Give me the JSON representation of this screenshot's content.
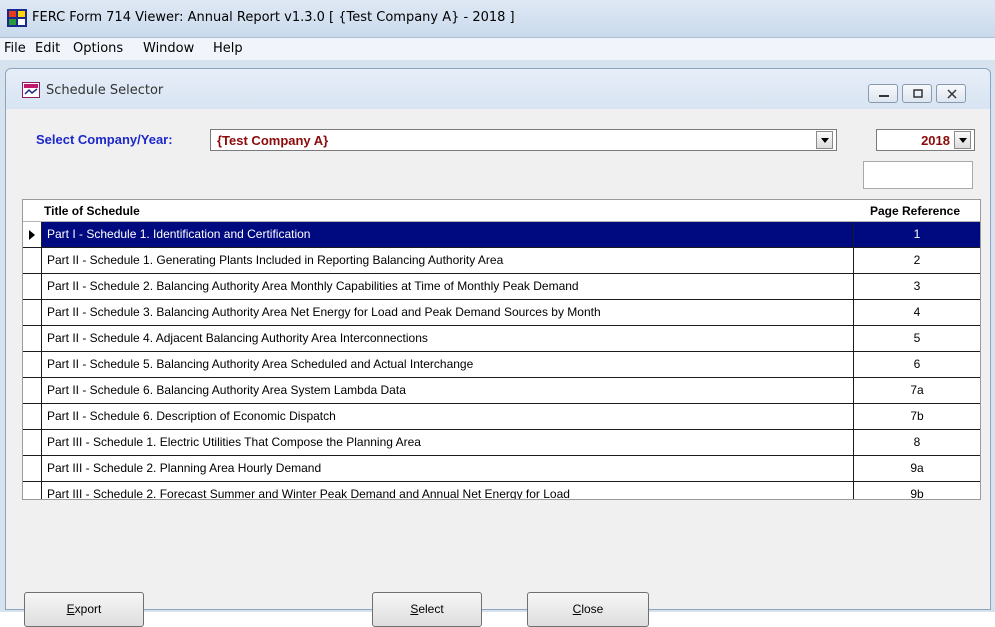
{
  "app": {
    "title": "FERC Form 714 Viewer: Annual Report v1.3.0   [ {Test Company A} - 2018 ]",
    "menu": [
      "File",
      "Edit",
      "Options",
      "Window",
      "Help"
    ]
  },
  "child_window": {
    "title": "Schedule Selector"
  },
  "selector": {
    "label": "Select Company/Year:",
    "company_value": "{Test Company A}",
    "year_value": "2018"
  },
  "grid": {
    "columns": [
      "Title of Schedule",
      "Page Reference"
    ],
    "rows": [
      {
        "title": "Part I - Schedule 1. Identification and Certification",
        "ref": "1"
      },
      {
        "title": "Part II - Schedule 1. Generating Plants Included in Reporting Balancing Authority Area",
        "ref": "2"
      },
      {
        "title": "Part II - Schedule 2.  Balancing Authority Area Monthly Capabilities at Time of Monthly Peak Demand",
        "ref": "3"
      },
      {
        "title": "Part II - Schedule 3. Balancing Authority Area Net Energy for Load and Peak Demand Sources by Month",
        "ref": "4"
      },
      {
        "title": "Part II - Schedule 4. Adjacent Balancing Authority Area Interconnections",
        "ref": "5"
      },
      {
        "title": "Part II - Schedule 5. Balancing Authority Area Scheduled and Actual Interchange",
        "ref": "6"
      },
      {
        "title": "Part II - Schedule 6. Balancing Authority Area System Lambda Data",
        "ref": "7a"
      },
      {
        "title": "Part II - Schedule 6. Description of Economic Dispatch",
        "ref": "7b"
      },
      {
        "title": "Part III - Schedule 1. Electric Utilities That Compose the Planning Area",
        "ref": "8"
      },
      {
        "title": "Part III - Schedule 2. Planning Area Hourly Demand",
        "ref": "9a"
      },
      {
        "title": "Part III - Schedule 2. Forecast Summer and Winter Peak Demand and Annual Net Energy for Load",
        "ref": "9b"
      }
    ]
  },
  "buttons": {
    "export": {
      "mnemonic": "E",
      "rest": "xport"
    },
    "select": {
      "mnemonic": "S",
      "rest": "elect"
    },
    "close": {
      "mnemonic": "C",
      "rest": "lose"
    }
  },
  "colors": {
    "selected_row": "#000a80",
    "label_blue": "#1d28c9",
    "value_red": "#8b0a0a"
  }
}
